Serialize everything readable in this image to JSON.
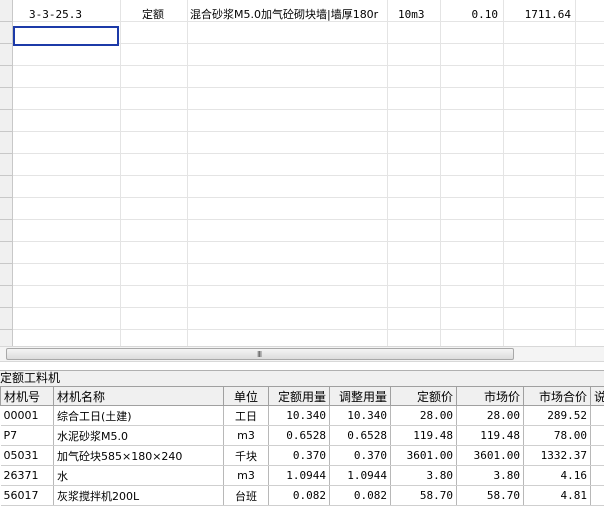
{
  "top_grid": {
    "row": {
      "code": "3-3-25.3",
      "type": "定额",
      "name": "混合砂浆M5.0加气砼砌块墙|墙厚180r",
      "unit": "10m3",
      "quantity": "0.10",
      "amount": "1711.64"
    }
  },
  "scrollbar": {
    "grip": "III"
  },
  "panel": {
    "title": "定额工料机",
    "columns": [
      "材机号",
      "材机名称",
      "单位",
      "定额用量",
      "调整用量",
      "定额价",
      "市场价",
      "市场合价",
      "说"
    ],
    "rows": [
      {
        "code": "00001",
        "name": "综合工日(土建)",
        "unit": "工日",
        "quota_qty": "10.340",
        "adj_qty": "10.340",
        "quota_price": "28.00",
        "market_price": "28.00",
        "market_total": "289.52"
      },
      {
        "code": "P7",
        "name": "水泥砂浆M5.0",
        "unit": "m3",
        "quota_qty": "0.6528",
        "adj_qty": "0.6528",
        "quota_price": "119.48",
        "market_price": "119.48",
        "market_total": "78.00"
      },
      {
        "code": "05031",
        "name": "加气砼块585×180×240",
        "unit": "千块",
        "quota_qty": "0.370",
        "adj_qty": "0.370",
        "quota_price": "3601.00",
        "market_price": "3601.00",
        "market_total": "1332.37"
      },
      {
        "code": "26371",
        "name": "水",
        "unit": "m3",
        "quota_qty": "1.0944",
        "adj_qty": "1.0944",
        "quota_price": "3.80",
        "market_price": "3.80",
        "market_total": "4.16"
      },
      {
        "code": "56017",
        "name": "灰浆搅拌机200L",
        "unit": "台班",
        "quota_qty": "0.082",
        "adj_qty": "0.082",
        "quota_price": "58.70",
        "market_price": "58.70",
        "market_total": "4.81"
      }
    ]
  }
}
